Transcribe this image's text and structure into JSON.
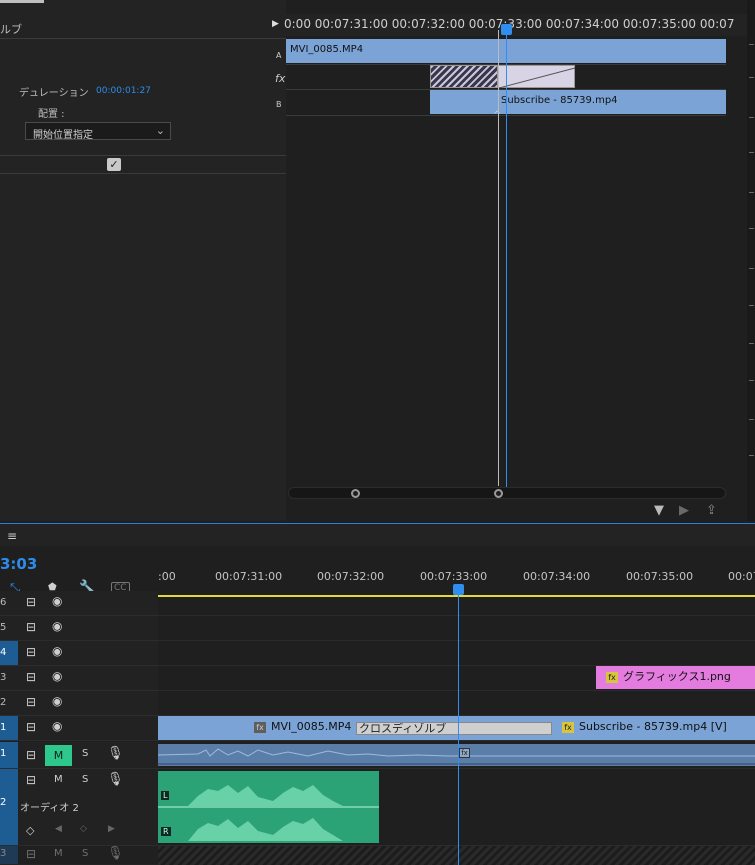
{
  "effect_panel": {
    "header_fragment": "ルブ",
    "duration_label": "デュレーション",
    "duration_value": "00:00:01:27",
    "alignment_label": "配置 :",
    "alignment_value": "開始位置指定",
    "track_letters": [
      "A",
      "fx",
      "B"
    ],
    "ruler_text": "0:00 00:07:31:00 00:07:32:00 00:07:33:00 00:07:34:00 00:07:35:00 00:07",
    "clip_a": "MVI_0085.MP4",
    "clip_b": "Subscribe - 85739.mp4"
  },
  "timeline": {
    "menu_icon": "≡",
    "timecode": "3:03",
    "ruler_labels": [
      ":00",
      "00:07:31:00",
      "00:07:32:00",
      "00:07:33:00",
      "00:07:34:00",
      "00:07:35:00",
      "00:07"
    ],
    "tracks": {
      "v6": "6",
      "v5": "5",
      "v4": "4",
      "v3": "3",
      "v2": "2",
      "v1": "1",
      "a1": "1",
      "a2": "2",
      "a3": "3"
    },
    "audio2_name": "オーディオ 2",
    "mute_label": "M",
    "solo_label": "S",
    "clip_graphics": "グラフィックス1.png",
    "clip_mvi": "MVI_0085.MP4",
    "transition_label": "クロスディゾルブ",
    "clip_subscribe": "Subscribe - 85739.mp4 [V]",
    "fx_badge": "fx",
    "channel_left": "L",
    "channel_right": "R"
  },
  "colors": {
    "accent_blue": "#2f8ef0",
    "video_clip": "#7ba3d6",
    "audio_clip": "#2ba376",
    "graphic_clip": "#e47ce0",
    "work_area": "#e5d93a"
  }
}
